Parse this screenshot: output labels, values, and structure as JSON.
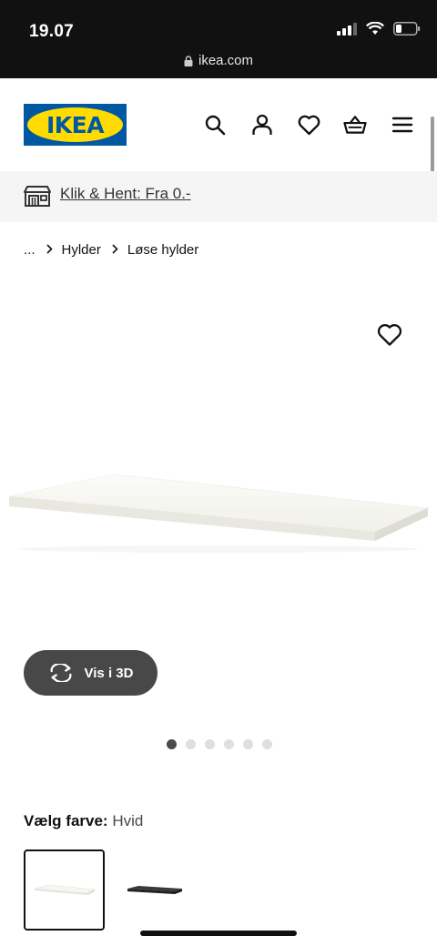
{
  "status": {
    "time": "19.07",
    "url": "ikea.com"
  },
  "header": {
    "logo_text": "IKEA",
    "icons": [
      "search-icon",
      "user-icon",
      "heart-icon",
      "basket-icon",
      "menu-icon"
    ]
  },
  "banner": {
    "icon": "store-icon",
    "link_text": "Klik & Hent: Fra 0.-"
  },
  "breadcrumb": {
    "items": [
      "...",
      "Hylder",
      "Løse hylder"
    ]
  },
  "product": {
    "favorite_icon": "heart-icon",
    "view_3d_label": "Vis i 3D",
    "image_count": 6,
    "active_image_index": 0
  },
  "color_picker": {
    "label": "Vælg farve:",
    "selected": "Hvid",
    "swatches": [
      {
        "color": "#f2f1ec",
        "selected": true
      },
      {
        "color": "#2b2b2b",
        "selected": false
      }
    ]
  },
  "colors": {
    "ikea_blue": "#0058a3",
    "ikea_yellow": "#ffdb00",
    "button_dark": "#484848"
  }
}
